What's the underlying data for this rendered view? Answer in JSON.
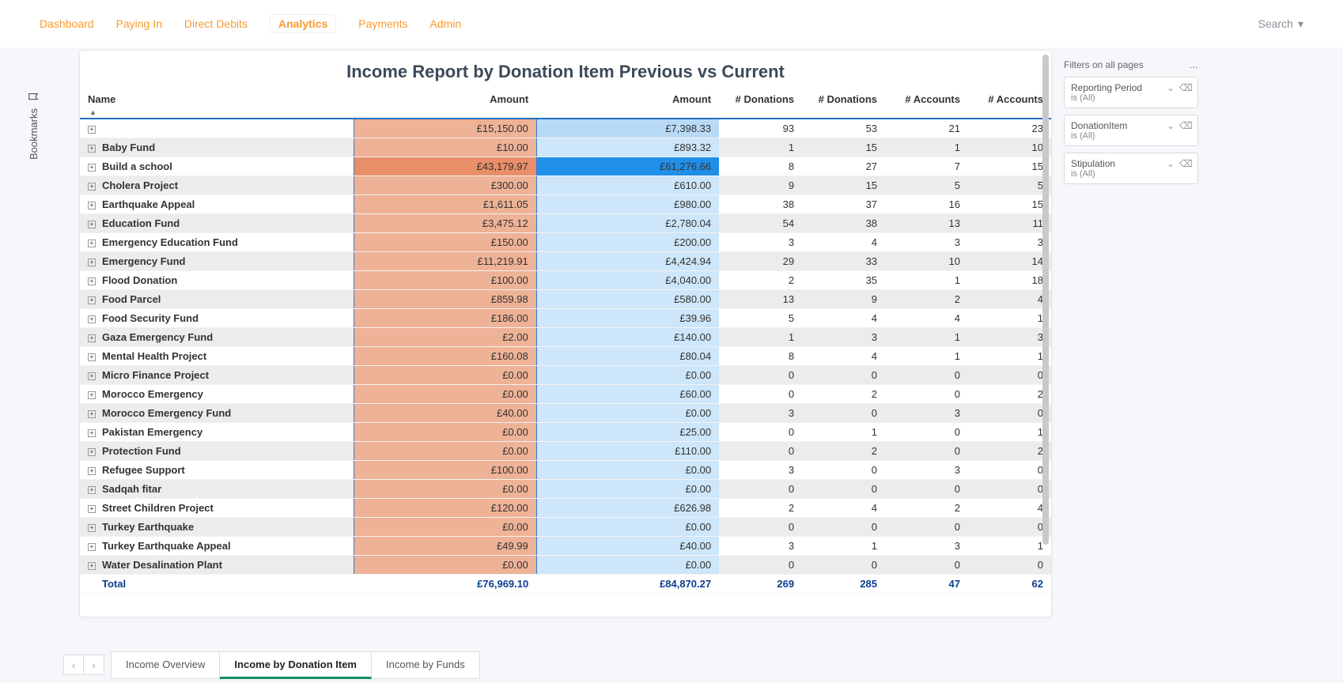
{
  "nav": {
    "items": [
      "Dashboard",
      "Paying In",
      "Direct Debits",
      "Analytics",
      "Payments",
      "Admin"
    ],
    "active": 3,
    "search_label": "Search"
  },
  "bookmarks_label": "Bookmarks",
  "report": {
    "title": "Income Report by Donation Item Previous vs Current",
    "columns": [
      "Name",
      "Amount",
      "Amount",
      "# Donations",
      "# Donations",
      "# Accounts",
      "# Accounts"
    ],
    "rows": [
      {
        "name": "",
        "a1": "£15,150.00",
        "a2": "£7,398.33",
        "d1": "93",
        "d2": "53",
        "ac1": "21",
        "ac2": "23",
        "bg1": "#eeb296",
        "bg2": "#b8daf7"
      },
      {
        "name": "Baby Fund",
        "a1": "£10.00",
        "a2": "£893.32",
        "d1": "1",
        "d2": "15",
        "ac1": "1",
        "ac2": "10",
        "bg1": "#eeb296",
        "bg2": "#cde6f9"
      },
      {
        "name": "Build a school",
        "a1": "£43,179.97",
        "a2": "£61,276.66",
        "d1": "8",
        "d2": "27",
        "ac1": "7",
        "ac2": "15",
        "bg1": "#e88e68",
        "bg2": "#1f8fe8"
      },
      {
        "name": "Cholera Project",
        "a1": "£300.00",
        "a2": "£610.00",
        "d1": "9",
        "d2": "15",
        "ac1": "5",
        "ac2": "5",
        "bg1": "#eeb296",
        "bg2": "#cde6f9"
      },
      {
        "name": "Earthquake Appeal",
        "a1": "£1,611.05",
        "a2": "£980.00",
        "d1": "38",
        "d2": "37",
        "ac1": "16",
        "ac2": "15",
        "bg1": "#eeb296",
        "bg2": "#cde6f9"
      },
      {
        "name": "Education Fund",
        "a1": "£3,475.12",
        "a2": "£2,780.04",
        "d1": "54",
        "d2": "38",
        "ac1": "13",
        "ac2": "11",
        "bg1": "#eeb296",
        "bg2": "#cde6f9"
      },
      {
        "name": "Emergency Education Fund",
        "a1": "£150.00",
        "a2": "£200.00",
        "d1": "3",
        "d2": "4",
        "ac1": "3",
        "ac2": "3",
        "bg1": "#eeb296",
        "bg2": "#cde6f9"
      },
      {
        "name": "Emergency Fund",
        "a1": "£11,219.91",
        "a2": "£4,424.94",
        "d1": "29",
        "d2": "33",
        "ac1": "10",
        "ac2": "14",
        "bg1": "#eeb296",
        "bg2": "#cde6f9"
      },
      {
        "name": "Flood Donation",
        "a1": "£100.00",
        "a2": "£4,040.00",
        "d1": "2",
        "d2": "35",
        "ac1": "1",
        "ac2": "18",
        "bg1": "#eeb296",
        "bg2": "#cde6f9"
      },
      {
        "name": "Food Parcel",
        "a1": "£859.98",
        "a2": "£580.00",
        "d1": "13",
        "d2": "9",
        "ac1": "2",
        "ac2": "4",
        "bg1": "#eeb296",
        "bg2": "#cde6f9"
      },
      {
        "name": "Food Security Fund",
        "a1": "£186.00",
        "a2": "£39.96",
        "d1": "5",
        "d2": "4",
        "ac1": "4",
        "ac2": "1",
        "bg1": "#eeb296",
        "bg2": "#cde6f9"
      },
      {
        "name": "Gaza Emergency Fund",
        "a1": "£2.00",
        "a2": "£140.00",
        "d1": "1",
        "d2": "3",
        "ac1": "1",
        "ac2": "3",
        "bg1": "#eeb296",
        "bg2": "#cde6f9"
      },
      {
        "name": "Mental Health Project",
        "a1": "£160.08",
        "a2": "£80.04",
        "d1": "8",
        "d2": "4",
        "ac1": "1",
        "ac2": "1",
        "bg1": "#eeb296",
        "bg2": "#cde6f9"
      },
      {
        "name": "Micro Finance Project",
        "a1": "£0.00",
        "a2": "£0.00",
        "d1": "0",
        "d2": "0",
        "ac1": "0",
        "ac2": "0",
        "bg1": "#eeb296",
        "bg2": "#cde6f9"
      },
      {
        "name": "Morocco Emergency",
        "a1": "£0.00",
        "a2": "£60.00",
        "d1": "0",
        "d2": "2",
        "ac1": "0",
        "ac2": "2",
        "bg1": "#eeb296",
        "bg2": "#cde6f9"
      },
      {
        "name": "Morocco Emergency Fund",
        "a1": "£40.00",
        "a2": "£0.00",
        "d1": "3",
        "d2": "0",
        "ac1": "3",
        "ac2": "0",
        "bg1": "#eeb296",
        "bg2": "#cde6f9"
      },
      {
        "name": "Pakistan Emergency",
        "a1": "£0.00",
        "a2": "£25.00",
        "d1": "0",
        "d2": "1",
        "ac1": "0",
        "ac2": "1",
        "bg1": "#eeb296",
        "bg2": "#cde6f9"
      },
      {
        "name": "Protection Fund",
        "a1": "£0.00",
        "a2": "£110.00",
        "d1": "0",
        "d2": "2",
        "ac1": "0",
        "ac2": "2",
        "bg1": "#eeb296",
        "bg2": "#cde6f9"
      },
      {
        "name": "Refugee Support",
        "a1": "£100.00",
        "a2": "£0.00",
        "d1": "3",
        "d2": "0",
        "ac1": "3",
        "ac2": "0",
        "bg1": "#eeb296",
        "bg2": "#cde6f9"
      },
      {
        "name": "Sadqah fitar",
        "a1": "£0.00",
        "a2": "£0.00",
        "d1": "0",
        "d2": "0",
        "ac1": "0",
        "ac2": "0",
        "bg1": "#eeb296",
        "bg2": "#cde6f9"
      },
      {
        "name": "Street Children Project",
        "a1": "£120.00",
        "a2": "£626.98",
        "d1": "2",
        "d2": "4",
        "ac1": "2",
        "ac2": "4",
        "bg1": "#eeb296",
        "bg2": "#cde6f9"
      },
      {
        "name": "Turkey Earthquake",
        "a1": "£0.00",
        "a2": "£0.00",
        "d1": "0",
        "d2": "0",
        "ac1": "0",
        "ac2": "0",
        "bg1": "#eeb296",
        "bg2": "#cde6f9"
      },
      {
        "name": "Turkey Earthquake Appeal",
        "a1": "£49.99",
        "a2": "£40.00",
        "d1": "3",
        "d2": "1",
        "ac1": "3",
        "ac2": "1",
        "bg1": "#eeb296",
        "bg2": "#cde6f9"
      },
      {
        "name": "Water Desalination Plant",
        "a1": "£0.00",
        "a2": "£0.00",
        "d1": "0",
        "d2": "0",
        "ac1": "0",
        "ac2": "0",
        "bg1": "#eeb296",
        "bg2": "#cde6f9"
      }
    ],
    "total": {
      "label": "Total",
      "a1": "£76,969.10",
      "a2": "£84,870.27",
      "d1": "269",
      "d2": "285",
      "ac1": "47",
      "ac2": "62"
    }
  },
  "filters": {
    "header": "Filters on all pages",
    "cards": [
      {
        "title": "Reporting Period",
        "value": "is (All)"
      },
      {
        "title": "DonationItem",
        "value": "is (All)"
      },
      {
        "title": "Stipulation",
        "value": "is (All)"
      }
    ]
  },
  "sheets": {
    "tabs": [
      "Income Overview",
      "Income by Donation Item",
      "Income by Funds"
    ],
    "active": 1
  }
}
